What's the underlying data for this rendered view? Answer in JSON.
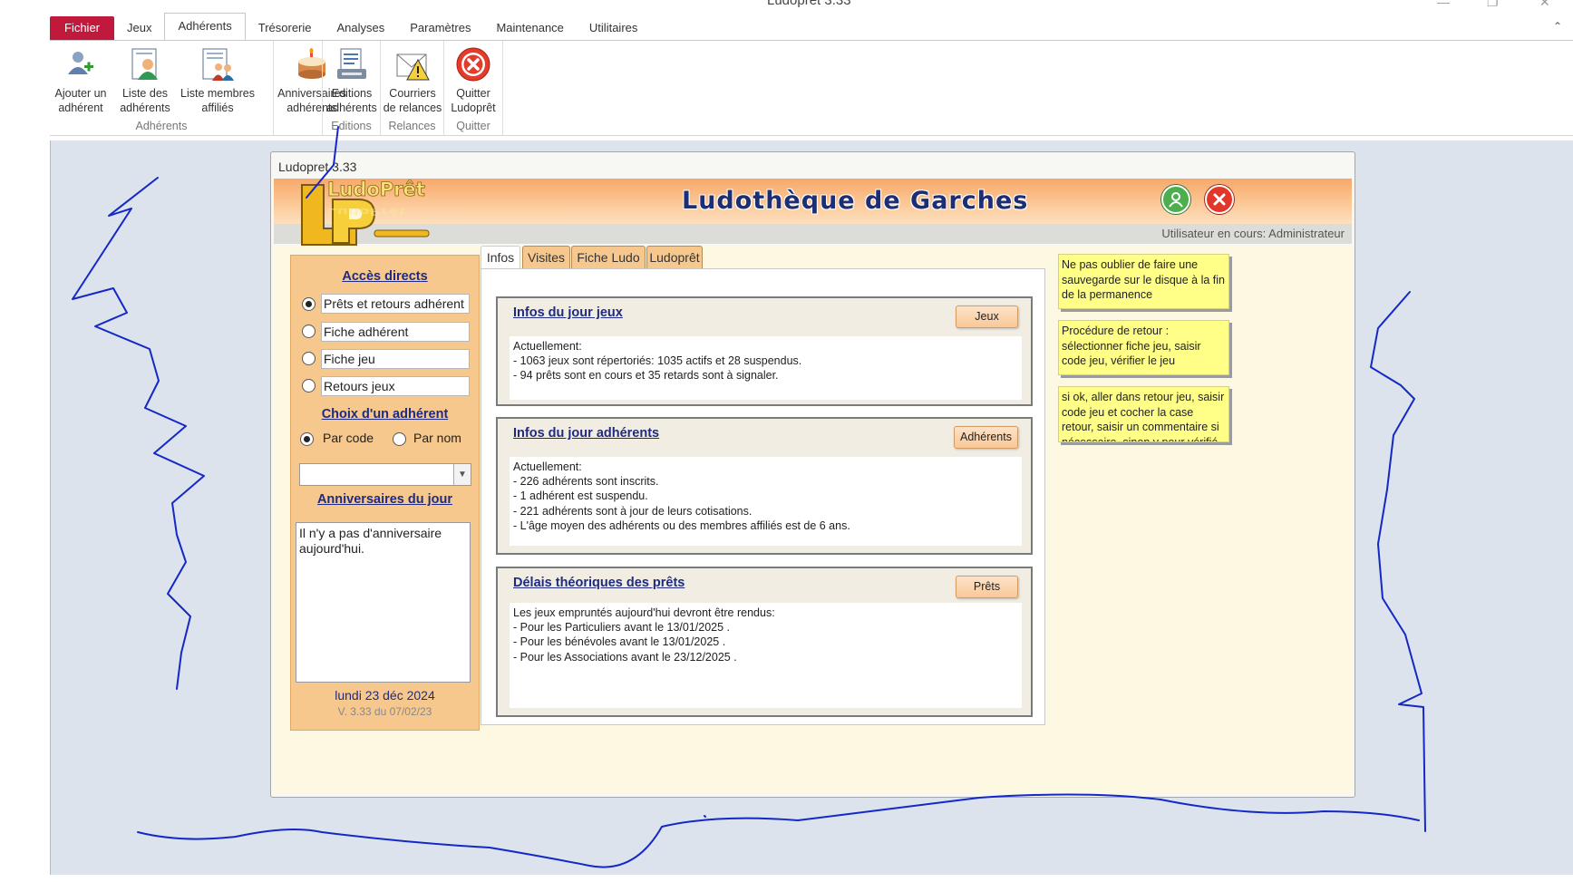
{
  "window": {
    "title": "Ludopret  3.33"
  },
  "ribbon": {
    "tabs": [
      {
        "label": "Fichier"
      },
      {
        "label": "Jeux"
      },
      {
        "label": "Adhérents"
      },
      {
        "label": "Trésorerie"
      },
      {
        "label": "Analyses"
      },
      {
        "label": "Paramètres"
      },
      {
        "label": "Maintenance"
      },
      {
        "label": "Utilitaires"
      }
    ],
    "active_tab": "Adhérents",
    "buttons": {
      "add_member": {
        "line1": "Ajouter un",
        "line2": "adhérent",
        "icon": "add-user-icon"
      },
      "member_list": {
        "line1": "Liste des",
        "line2": "adhérents",
        "icon": "member-list-icon"
      },
      "affiliated_list": {
        "line1": "Liste membres",
        "line2": "affiliés",
        "icon": "affiliated-list-icon"
      },
      "birthdays": {
        "line1": "Anniversaires",
        "line2": "adhérents",
        "icon": "birthday-cake-icon"
      },
      "editions": {
        "line1": "Editions",
        "line2": "adhérents",
        "icon": "print-icon"
      },
      "reminders": {
        "line1": "Courriers",
        "line2": "de relances",
        "icon": "warning-letter-icon"
      },
      "quit": {
        "line1": "Quitter",
        "line2": "Ludoprêt",
        "icon": "close-red-icon"
      }
    },
    "groups": {
      "adherents": "Adhérents",
      "editions": "Editions",
      "relances": "Relances",
      "quitter": "Quitter"
    }
  },
  "form": {
    "title": "Ludopret 3.33",
    "header_title": "Ludothèque de Garches",
    "logo_text": "LudoPrêt",
    "user_label": "Utilisateur en cours: Administrateur",
    "left_panel": {
      "direct_access_heading": "Accès directs",
      "direct_access_options": [
        {
          "label": "Prêts et retours adhérent",
          "selected": true
        },
        {
          "label": "Fiche adhérent",
          "selected": false
        },
        {
          "label": "Fiche jeu",
          "selected": false
        },
        {
          "label": "Retours jeux",
          "selected": false
        }
      ],
      "member_choice_heading": "Choix d'un adhérent",
      "by_code_label": "Par code",
      "by_name_label": "Par nom",
      "by_code_selected": true,
      "member_combo_value": "",
      "birthdays_heading": "Anniversaires du jour",
      "birthdays_text": "Il n'y a pas d'anniversaire aujourd'hui.",
      "today": "lundi 23 déc 2024",
      "version": "V. 3.33 du 07/02/23"
    },
    "tabs": [
      {
        "label": "Infos"
      },
      {
        "label": "Visites"
      },
      {
        "label": "Fiche Ludo"
      },
      {
        "label": "Ludoprêt"
      }
    ],
    "active_tab": "Infos",
    "info_boxes": {
      "games": {
        "title": "Infos du jour jeux",
        "button": "Jeux",
        "lines": [
          "Actuellement:",
          "- 1063 jeux sont répertoriés: 1035 actifs  et 28 suspendus.",
          "- 94 prêts sont en cours et 35 retards sont à signaler."
        ]
      },
      "members": {
        "title": "Infos du jour adhérents",
        "button": "Adhérents",
        "lines": [
          "Actuellement:",
          "- 226 adhérents sont inscrits.",
          "- 1 adhérent est suspendu.",
          "- 221 adhérents sont à jour de leurs cotisations.",
          "- L'âge moyen des adhérents ou des membres affiliés est de  6 ans."
        ]
      },
      "loans": {
        "title": "Délais théoriques des prêts",
        "button": "Prêts",
        "lines": [
          "Les jeux empruntés aujourd'hui devront être rendus:",
          "- Pour les Particuliers avant le 13/01/2025 .",
          "- Pour les bénévoles avant le 13/01/2025 .",
          "- Pour les Associations avant le 23/12/2025 ."
        ]
      }
    },
    "notes": [
      "Ne pas oublier de faire une sauvegarde sur le disque à la fin de la permanence",
      "Procédure de retour : sélectionner fiche jeu, saisir code jeu, vérifier le jeu",
      "si ok, aller dans retour jeu, saisir code jeu et cocher la case retour, saisir un commentaire si nécessaire, sinon y pour vérifié"
    ]
  },
  "colors": {
    "file_tab": "#c1193b",
    "header_orange": "#f7a86a",
    "left_panel": "#f6c88e",
    "heading_blue": "#1f2b80",
    "note_yellow": "#ffff88",
    "annotation_ink": "#1428c8"
  }
}
